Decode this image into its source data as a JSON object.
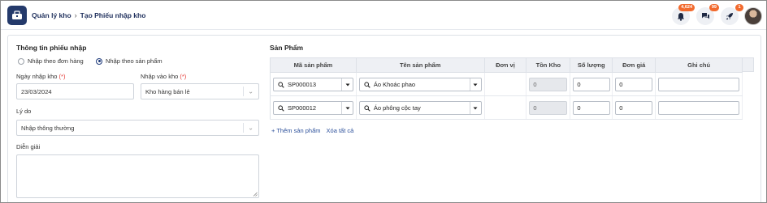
{
  "header": {
    "breadcrumb": [
      "Quản lý kho",
      "Tạo Phiếu nhập kho"
    ],
    "notifications_badge": "4,624",
    "messages_badge": "99",
    "rocket_badge": "1"
  },
  "info": {
    "title": "Thông tin phiếu nhập",
    "radio_by_order": "Nhập theo đơn hàng",
    "radio_by_product": "Nhập theo sản phẩm",
    "date_label": "Ngày nhập kho",
    "date_value": "23/03/2024",
    "warehouse_label": "Nhập vào kho",
    "warehouse_value": "Kho hàng bán lẻ",
    "reason_label": "Lý do",
    "reason_value": "Nhập thông thường",
    "description_label": "Diễn giải",
    "required_mark": "(*)"
  },
  "products": {
    "title": "Sản Phẩm",
    "columns": [
      "Mã sản phẩm",
      "Tên sản phẩm",
      "Đơn vị",
      "Tồn Kho",
      "Số lượng",
      "Đơn giá",
      "Ghi chú"
    ],
    "rows": [
      {
        "code": "SP000013",
        "name": "Áo Khoác phao",
        "unit": "",
        "stock": "0",
        "qty": "0",
        "price": "0",
        "note": ""
      },
      {
        "code": "SP000012",
        "name": "Áo phông cộc tay",
        "unit": "",
        "stock": "0",
        "qty": "0",
        "price": "0",
        "note": ""
      }
    ],
    "add_link": "+ Thêm sản phẩm",
    "clear_link": "Xóa tất cả"
  },
  "colors": {
    "primary": "#243a6b",
    "badge": "#f26a2e",
    "link": "#2b4f9a",
    "required": "#e53935"
  }
}
